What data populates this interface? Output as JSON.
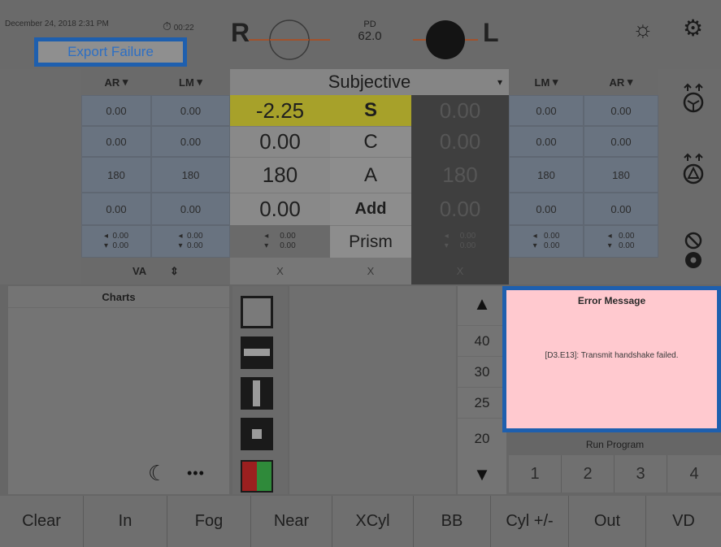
{
  "topbar": {
    "datetime": "December 24, 2018  2:31 PM",
    "timer": "00:22",
    "export_label": "Export Failure",
    "right_eye_letter": "R",
    "left_eye_letter": "L",
    "pd_label": "PD",
    "pd_value": "62.0"
  },
  "right_table": {
    "col1_header": "AR",
    "col2_header": "LM",
    "rows": [
      [
        "0.00",
        "0.00"
      ],
      [
        "0.00",
        "0.00"
      ],
      [
        "180",
        "180"
      ],
      [
        "0.00",
        "0.00"
      ]
    ],
    "prism_rows": [
      [
        "0.00",
        "0.00"
      ],
      [
        "0.00",
        "0.00"
      ]
    ],
    "va_label": "VA"
  },
  "subjective": {
    "header": "Subjective",
    "right_values": [
      "-2.25",
      "0.00",
      "180",
      "0.00"
    ],
    "labels": [
      "S",
      "C",
      "A",
      "Add",
      "Prism"
    ],
    "left_values": [
      "0.00",
      "0.00",
      "180",
      "0.00"
    ],
    "right_prism": [
      "0.00",
      "0.00"
    ],
    "left_prism": [
      "0.00",
      "0.00"
    ],
    "va_marks": [
      "X",
      "X",
      "X"
    ]
  },
  "left_table": {
    "col1_header": "LM",
    "col2_header": "AR",
    "rows": [
      [
        "0.00",
        "0.00"
      ],
      [
        "0.00",
        "0.00"
      ],
      [
        "180",
        "180"
      ],
      [
        "0.00",
        "0.00"
      ]
    ],
    "prism_rows": [
      [
        "0.00",
        "0.00"
      ],
      [
        "0.00",
        "0.00"
      ]
    ]
  },
  "charts": {
    "title": "Charts",
    "more_label": "•••"
  },
  "scale": {
    "values": [
      "40",
      "30",
      "25",
      "20"
    ]
  },
  "error": {
    "title": "Error Message",
    "message": "[D3.E13]: Transmit handshake failed."
  },
  "run_program": {
    "title": "Run Program",
    "buttons": [
      "1",
      "2",
      "3",
      "4"
    ]
  },
  "bottom_bar": [
    "Clear",
    "In",
    "Fog",
    "Near",
    "XCyl",
    "BB",
    "Cyl +/-",
    "Out",
    "VD"
  ],
  "colors": {
    "accent_blue": "#1e5fae",
    "highlight_yellow": "#a7a12a",
    "error_bg": "#ffc9cf"
  }
}
